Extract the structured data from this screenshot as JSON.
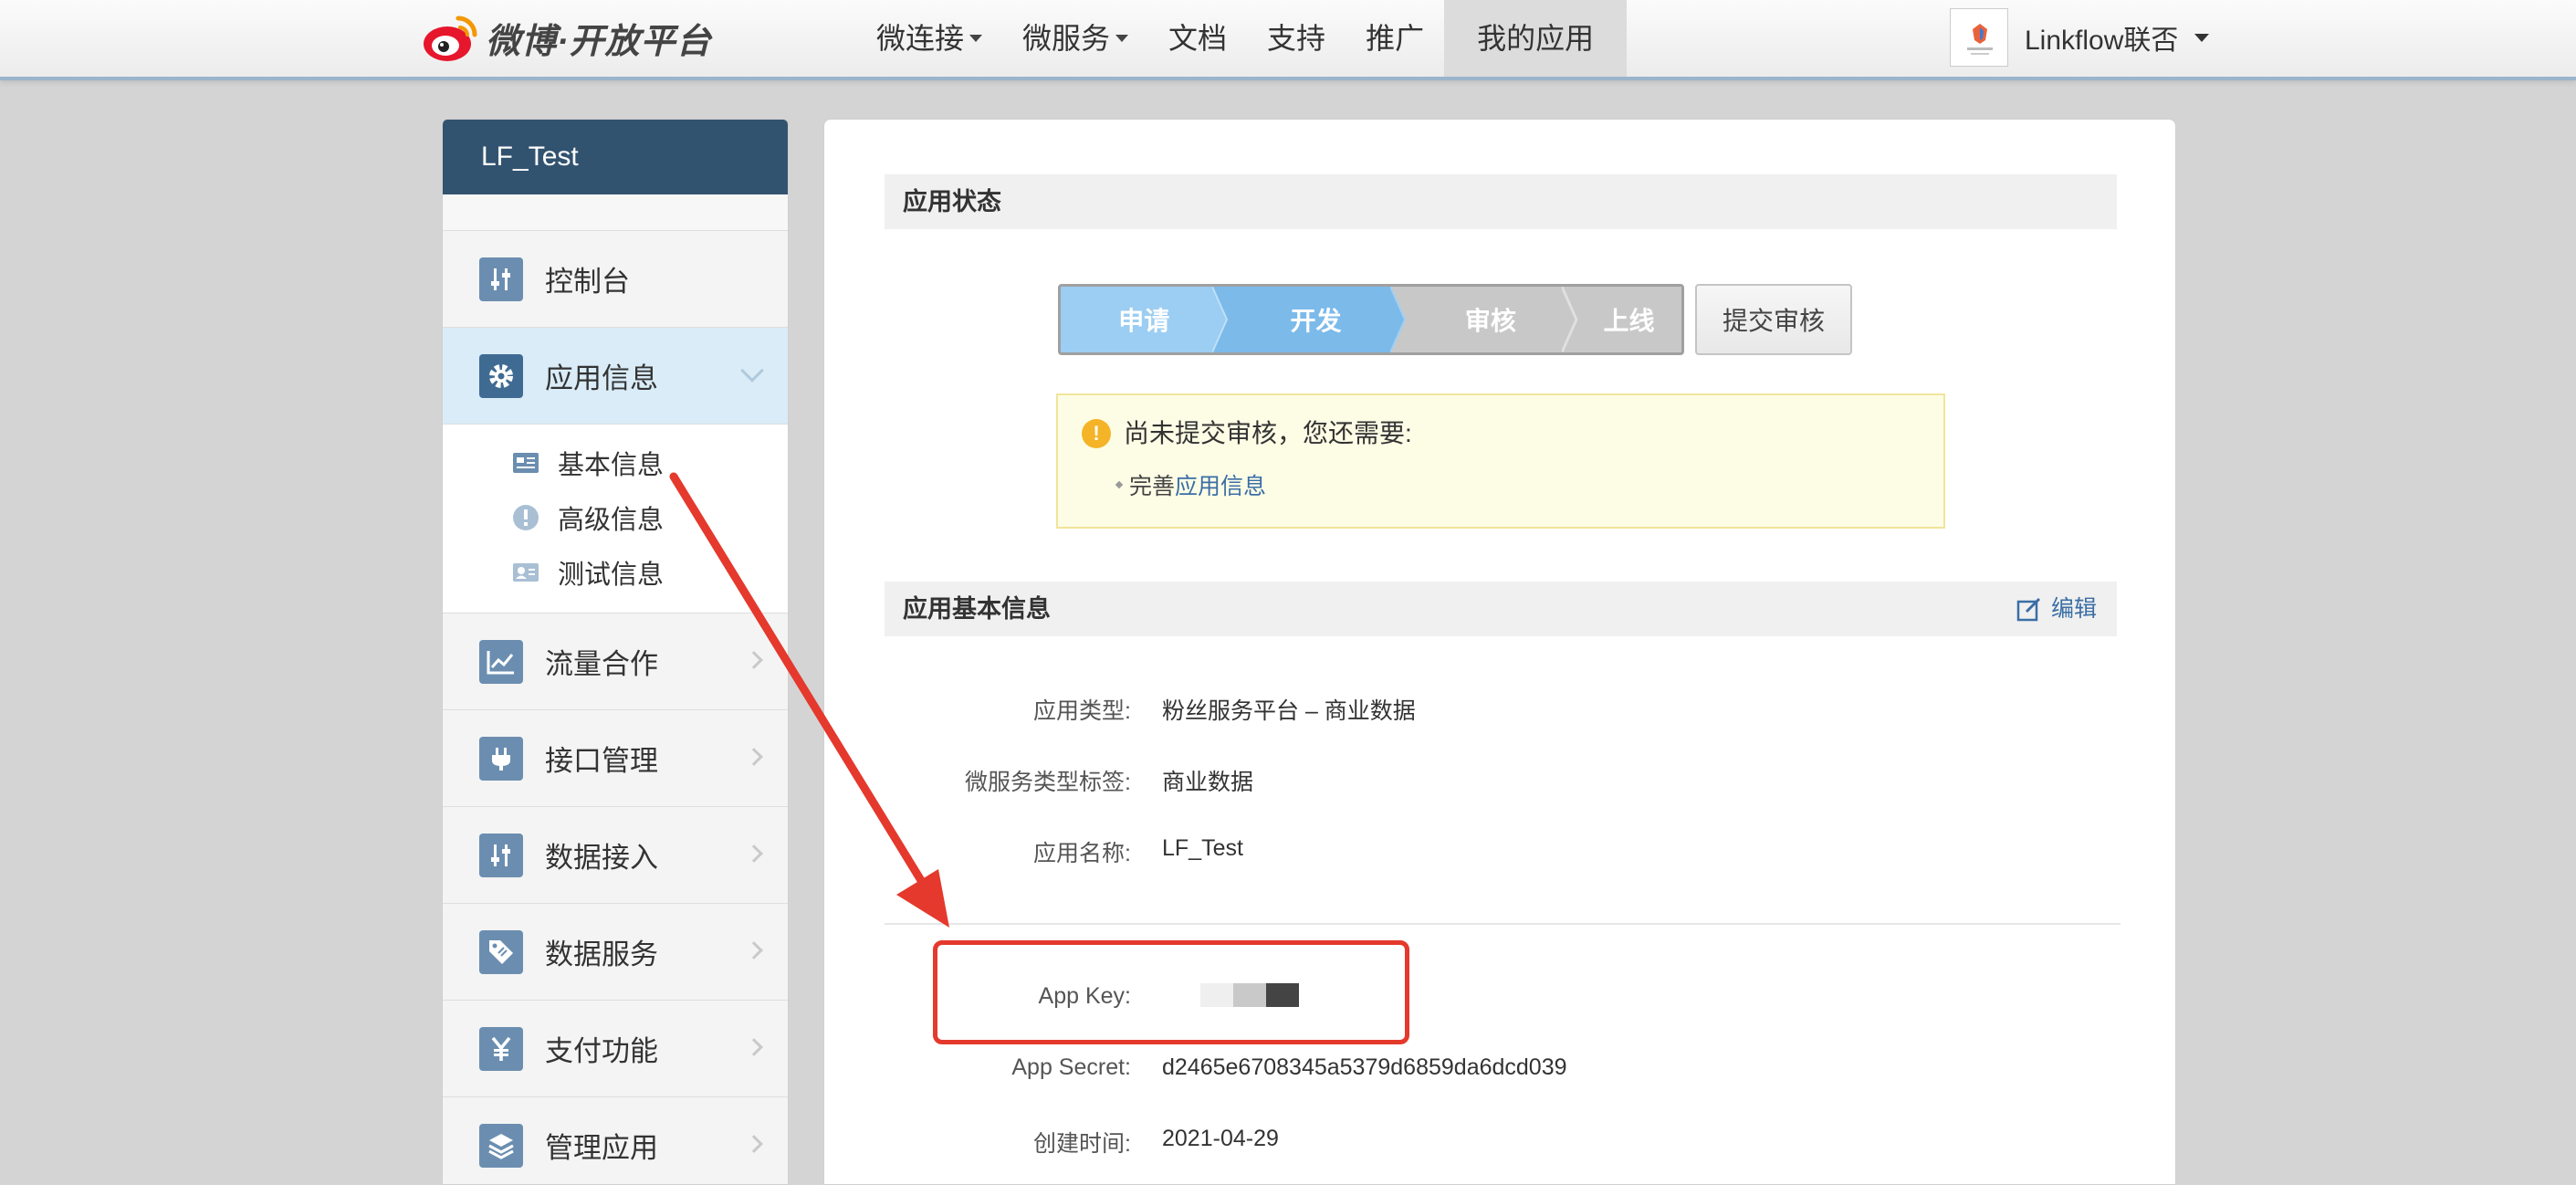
{
  "topbar": {
    "logo_text": "微博·开放平台",
    "nav": [
      {
        "label": "微连接",
        "dropdown": true
      },
      {
        "label": "微服务",
        "dropdown": true
      },
      {
        "label": "文档",
        "dropdown": false
      },
      {
        "label": "支持",
        "dropdown": false
      },
      {
        "label": "推广",
        "dropdown": false
      },
      {
        "label": "我的应用",
        "dropdown": false,
        "active": true
      }
    ],
    "user_name": "Linkflow联否"
  },
  "sidebar": {
    "app_name": "LF_Test",
    "items": [
      {
        "label": "控制台",
        "icon": "sliders-icon"
      },
      {
        "label": "应用信息",
        "icon": "gear-icon",
        "active": true,
        "expanded": true
      },
      {
        "label": "流量合作",
        "icon": "chart-line-icon"
      },
      {
        "label": "接口管理",
        "icon": "plug-icon"
      },
      {
        "label": "数据接入",
        "icon": "sliders-icon"
      },
      {
        "label": "数据服务",
        "icon": "tag-icon"
      },
      {
        "label": "支付功能",
        "icon": "yen-icon"
      },
      {
        "label": "管理应用",
        "icon": "layers-icon"
      }
    ],
    "sub_items": [
      {
        "label": "基本信息",
        "icon": "id-card-icon"
      },
      {
        "label": "高级信息",
        "icon": "exclamation-circle-icon"
      },
      {
        "label": "测试信息",
        "icon": "user-card-icon"
      }
    ]
  },
  "status": {
    "title": "应用状态",
    "steps": [
      {
        "label": "申请",
        "state": "done"
      },
      {
        "label": "开发",
        "state": "current"
      },
      {
        "label": "审核",
        "state": "todo"
      },
      {
        "label": "上线",
        "state": "todo"
      }
    ],
    "submit_label": "提交审核",
    "notice_title": "尚未提交审核，您还需要:",
    "notice_prefix": "完善",
    "notice_link": "应用信息"
  },
  "basic": {
    "title": "应用基本信息",
    "edit_label": "编辑",
    "rows": [
      {
        "label": "应用类型:",
        "value": "粉丝服务平台  –  商业数据"
      },
      {
        "label": "微服务类型标签:",
        "value": "商业数据"
      },
      {
        "label": "应用名称:",
        "value": "LF_Test"
      },
      {
        "label": "App Key:",
        "value": ""
      },
      {
        "label": "App Secret:",
        "value": "d2465e6708345a5379d6859da6dcd039"
      },
      {
        "label": "创建时间:",
        "value": "2021-04-29"
      }
    ]
  },
  "colors": {
    "accent": "#32536f",
    "highlight": "#e4392c",
    "link": "#3a6ea5"
  }
}
